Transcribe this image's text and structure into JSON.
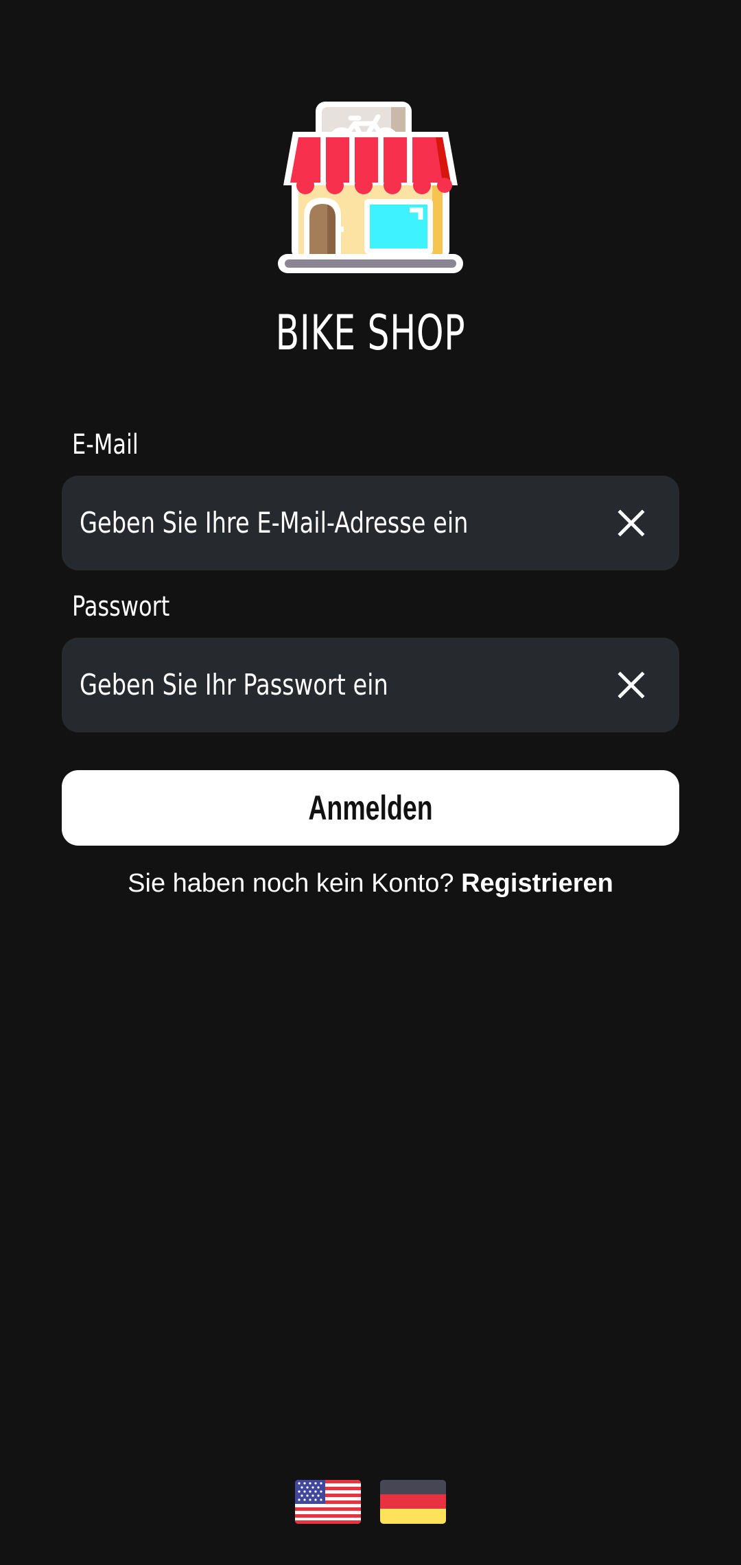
{
  "app": {
    "title": "BIKE SHOP",
    "logo_icon": "bike-shop-storefront-icon"
  },
  "email": {
    "label": "E-Mail",
    "placeholder": "Geben Sie Ihre E-Mail-Adresse ein",
    "value": "",
    "clear_icon": "close-icon"
  },
  "password": {
    "label": "Passwort",
    "placeholder": "Geben Sie Ihr Passwort ein",
    "value": "",
    "clear_icon": "close-icon"
  },
  "login_button": {
    "label": "Anmelden"
  },
  "signup": {
    "prompt": "Sie haben noch kein Konto? ",
    "link": "Registrieren"
  },
  "languages": [
    {
      "code": "en-US",
      "icon": "us-flag-icon"
    },
    {
      "code": "de",
      "icon": "german-flag-icon"
    }
  ],
  "colors": {
    "background": "#121212",
    "field_background": "#262a2e",
    "button_background": "#ffffff",
    "text": "#ffffff"
  }
}
